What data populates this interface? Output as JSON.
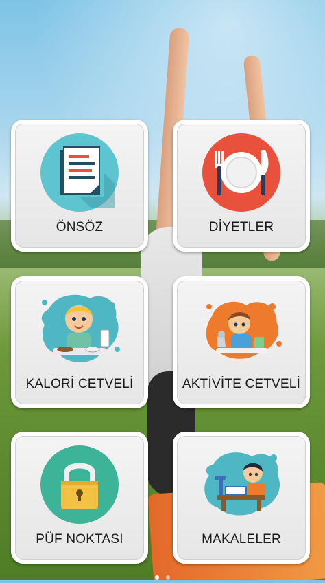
{
  "menu": {
    "items": [
      {
        "label": "ÖNSÖZ",
        "icon": "document-icon"
      },
      {
        "label": "DİYETLER",
        "icon": "plate-cutlery-icon"
      },
      {
        "label": "KALORİ CETVELİ",
        "icon": "child-eating-icon"
      },
      {
        "label": "AKTİVİTE CETVELİ",
        "icon": "child-activity-icon"
      },
      {
        "label": "PÜF NOKTASI",
        "icon": "padlock-icon"
      },
      {
        "label": "MAKALELER",
        "icon": "child-reading-icon"
      }
    ]
  },
  "colors": {
    "document_circle": "#5ec4cf",
    "plate_circle": "#e8513b",
    "lock_circle": "#3db397",
    "blob_teal": "#4fb7c4",
    "blob_orange": "#ee7a2c"
  }
}
